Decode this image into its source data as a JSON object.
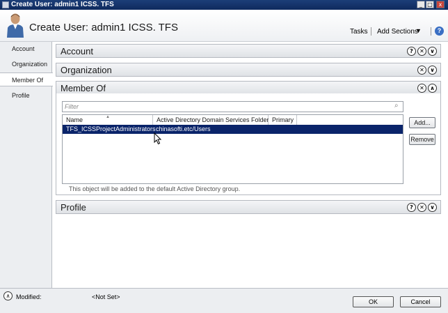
{
  "window": {
    "title": "Create User: admin1 ICSS. TFS",
    "controls": {
      "minimize": "_",
      "maximize": "□",
      "close": "x"
    }
  },
  "header": {
    "title": "Create User: admin1 ICSS. TFS",
    "icon": "user-avatar-icon",
    "tasks_label": "Tasks",
    "add_sections_label": "Add Sections",
    "help_label": "?"
  },
  "sidebar": {
    "items": [
      {
        "label": "Account"
      },
      {
        "label": "Organization"
      },
      {
        "label": "Member Of",
        "active": true
      },
      {
        "label": "Profile"
      }
    ]
  },
  "sections": {
    "account": {
      "title": "Account"
    },
    "organization": {
      "title": "Organization"
    },
    "member_of": {
      "title": "Member Of"
    },
    "profile": {
      "title": "Profile"
    }
  },
  "member_of": {
    "filter_placeholder": "Filter",
    "columns": [
      "Name",
      "Active Directory Domain Services Folder",
      "Primary"
    ],
    "rows": [
      {
        "name": "TFS_ICSSProjectAdministrators",
        "folder": "chinasofti.etc/Users",
        "primary": ""
      }
    ],
    "add_label": "Add...",
    "remove_label": "Remove",
    "note": "This object will be added to the default Active Directory group."
  },
  "footer": {
    "modified_label": "Modified:",
    "modified_value": "<Not Set>",
    "ok_label": "OK",
    "cancel_label": "Cancel"
  },
  "colors": {
    "titlebar": "#0f2a5e",
    "selection": "#0a246a",
    "panel": "#eceef1"
  }
}
